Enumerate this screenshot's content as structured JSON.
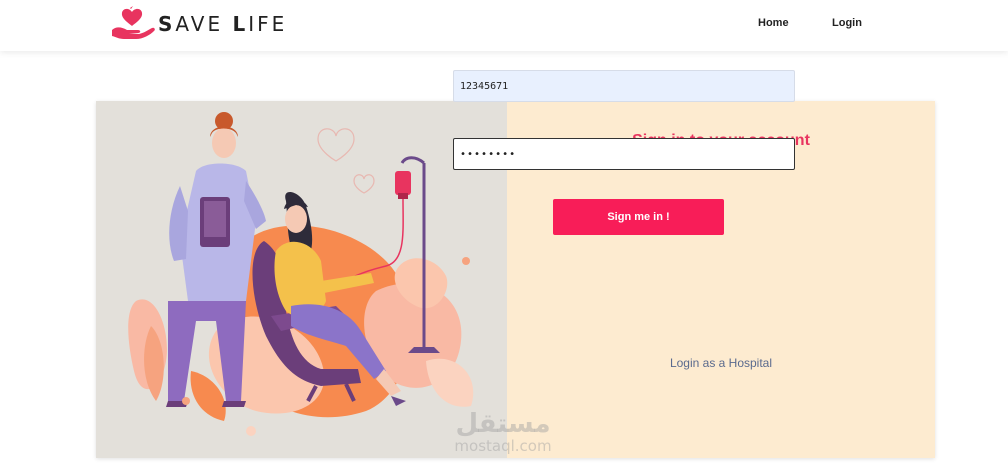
{
  "navbar": {
    "logo": {
      "prefix_initial": "S",
      "prefix_rest": "AVE ",
      "suffix_initial": "L",
      "suffix_rest": "IFE",
      "icon": "heart-hand-icon"
    },
    "links": [
      {
        "label": "Home"
      },
      {
        "label": "Login"
      }
    ]
  },
  "illustration": {
    "description_icon": "blood-donation-illustration"
  },
  "login_form": {
    "title": "Sign in to your account",
    "username_value": "12345671",
    "password_value": "••••••••",
    "submit_label": "Sign me in !",
    "hospital_link": "Login as a Hospital"
  },
  "watermark": {
    "arabic": "مستقل",
    "latin": "mostaql.com"
  },
  "colors": {
    "accent": "#f81d58",
    "title": "#e8345f",
    "panel": "#fdebd0",
    "illustration_bg": "#e3e0da"
  }
}
